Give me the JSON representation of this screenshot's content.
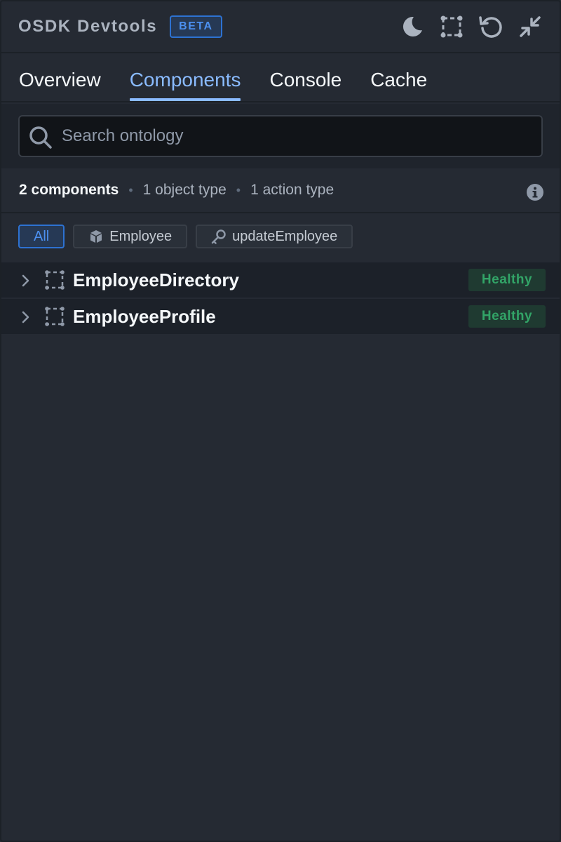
{
  "header": {
    "title": "OSDK Devtools",
    "badge": "BETA",
    "actions": [
      "moon-icon",
      "select-component-icon",
      "refresh-icon",
      "minimize-icon"
    ]
  },
  "tabs": [
    {
      "label": "Overview",
      "active": false
    },
    {
      "label": "Components",
      "active": true
    },
    {
      "label": "Console",
      "active": false
    },
    {
      "label": "Cache",
      "active": false
    }
  ],
  "search": {
    "placeholder": "Search ontology",
    "value": ""
  },
  "summary": {
    "count": "2 components",
    "object_types": "1 object type",
    "action_types": "1 action type",
    "separator": "•"
  },
  "filters": [
    {
      "label": "All",
      "active": true,
      "icon": ""
    },
    {
      "label": "Employee",
      "active": false,
      "icon": "cube-icon"
    },
    {
      "label": "updateEmployee",
      "active": false,
      "icon": "key-icon"
    }
  ],
  "components": [
    {
      "name": "EmployeeDirectory",
      "status": "Healthy"
    },
    {
      "name": "EmployeeProfile",
      "status": "Healthy"
    }
  ],
  "colors": {
    "accent": "#8abbff",
    "healthy": "#32a467",
    "background": "#252a33"
  }
}
